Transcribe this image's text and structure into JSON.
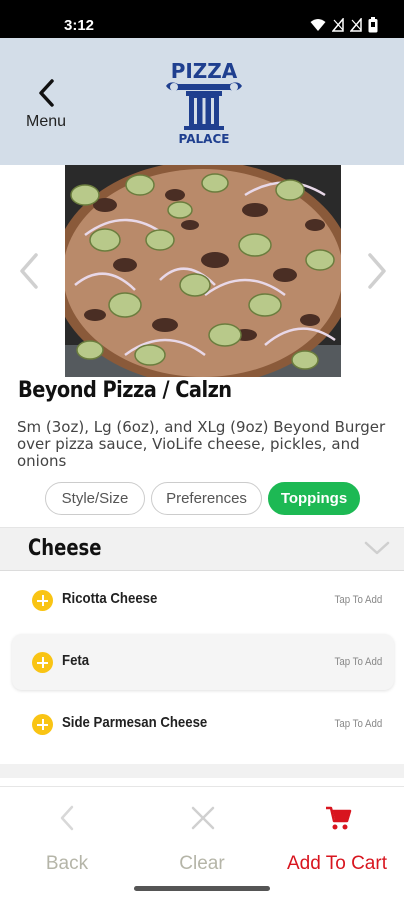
{
  "status_bar": {
    "time": "3:12"
  },
  "header": {
    "menu_label": "Menu",
    "logo_text_top": "PIZZA",
    "logo_text_bottom": "PALACE"
  },
  "item": {
    "title": "Beyond Pizza / Calzn",
    "description": "Sm (3oz), Lg (6oz), and XLg (9oz) Beyond Burger over pizza sauce, VioLife cheese, pickles, and onions"
  },
  "tabs": [
    {
      "label": "Style/Size",
      "active": false
    },
    {
      "label": "Preferences",
      "active": false
    },
    {
      "label": "Toppings",
      "active": true
    }
  ],
  "section": {
    "title": "Cheese",
    "options": [
      {
        "label": "Ricotta Cheese",
        "hint": "Tap To Add"
      },
      {
        "label": "Feta",
        "hint": "Tap To Add"
      },
      {
        "label": "Side Parmesan Cheese",
        "hint": "Tap To Add"
      }
    ]
  },
  "bottom_bar": {
    "back_label": "Back",
    "clear_label": "Clear",
    "add_to_cart_label": "Add To Cart"
  },
  "colors": {
    "header_bg": "#d3dde8",
    "active_tab": "#1db954",
    "add_icon": "#f9c414",
    "cart_red": "#d8151f",
    "logo_blue": "#1f3f8f"
  }
}
